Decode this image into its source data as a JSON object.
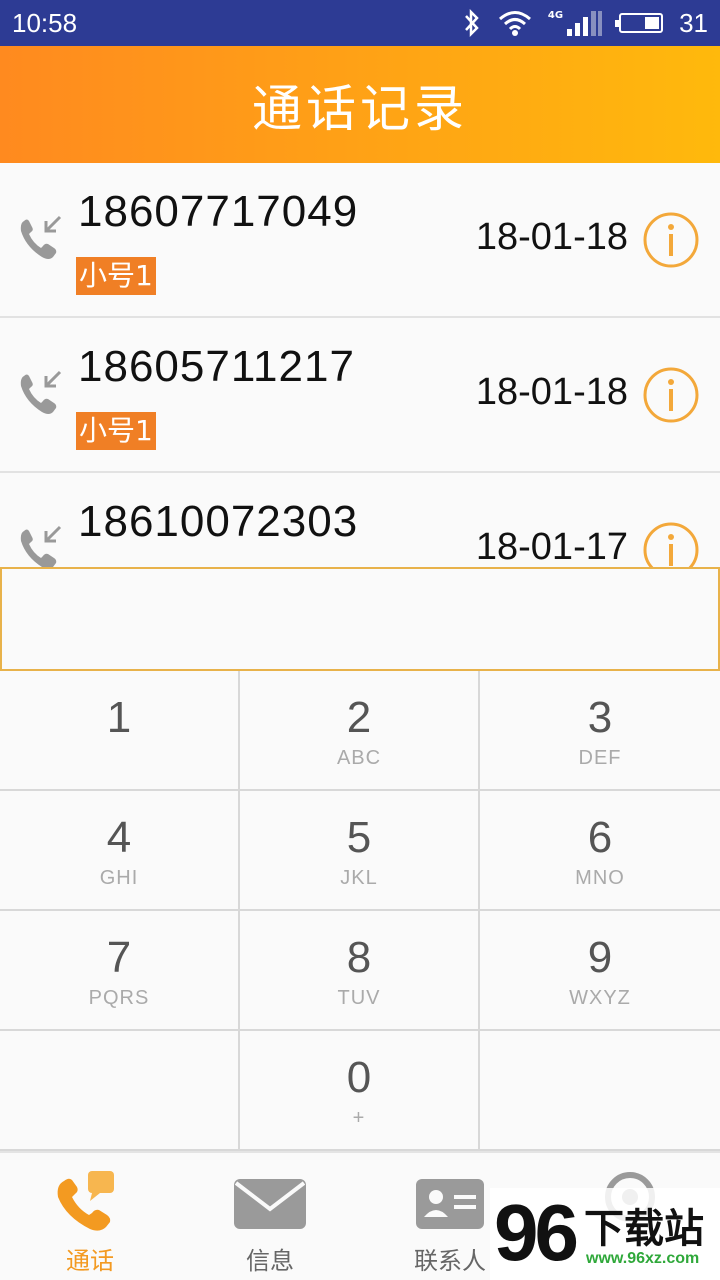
{
  "status_bar": {
    "time": "10:58",
    "network": "4G",
    "battery": "31"
  },
  "header": {
    "title": "通话记录"
  },
  "calls": [
    {
      "number": "18607717049",
      "tag": "小号1",
      "date": "18-01-18"
    },
    {
      "number": "18605711217",
      "tag": "小号1",
      "date": "18-01-18"
    },
    {
      "number": "18610072303",
      "tag": "",
      "date": "18-01-17"
    }
  ],
  "dial_input": {
    "value": ""
  },
  "keypad": [
    {
      "digit": "1",
      "letters": ""
    },
    {
      "digit": "2",
      "letters": "ABC"
    },
    {
      "digit": "3",
      "letters": "DEF"
    },
    {
      "digit": "4",
      "letters": "GHI"
    },
    {
      "digit": "5",
      "letters": "JKL"
    },
    {
      "digit": "6",
      "letters": "MNO"
    },
    {
      "digit": "7",
      "letters": "PQRS"
    },
    {
      "digit": "8",
      "letters": "TUV"
    },
    {
      "digit": "9",
      "letters": "WXYZ"
    },
    {
      "digit": "",
      "letters": ""
    },
    {
      "digit": "0",
      "letters": "+"
    },
    {
      "digit": "",
      "letters": ""
    }
  ],
  "bottom_nav": [
    {
      "label": "通话",
      "icon": "phone-chat-icon",
      "active": true
    },
    {
      "label": "信息",
      "icon": "envelope-icon",
      "active": false
    },
    {
      "label": "联系人",
      "icon": "contact-card-icon",
      "active": false
    },
    {
      "label": "",
      "icon": "settings-icon",
      "active": false
    }
  ],
  "watermark": {
    "number": "96",
    "brand": "下载站",
    "url": "www.96xz.com"
  },
  "colors": {
    "accent": "#f39a21",
    "header_start": "#ff8a1f",
    "header_end": "#ffb90c",
    "tag_bg": "#f07f25",
    "status_bar": "#2d3b94"
  }
}
